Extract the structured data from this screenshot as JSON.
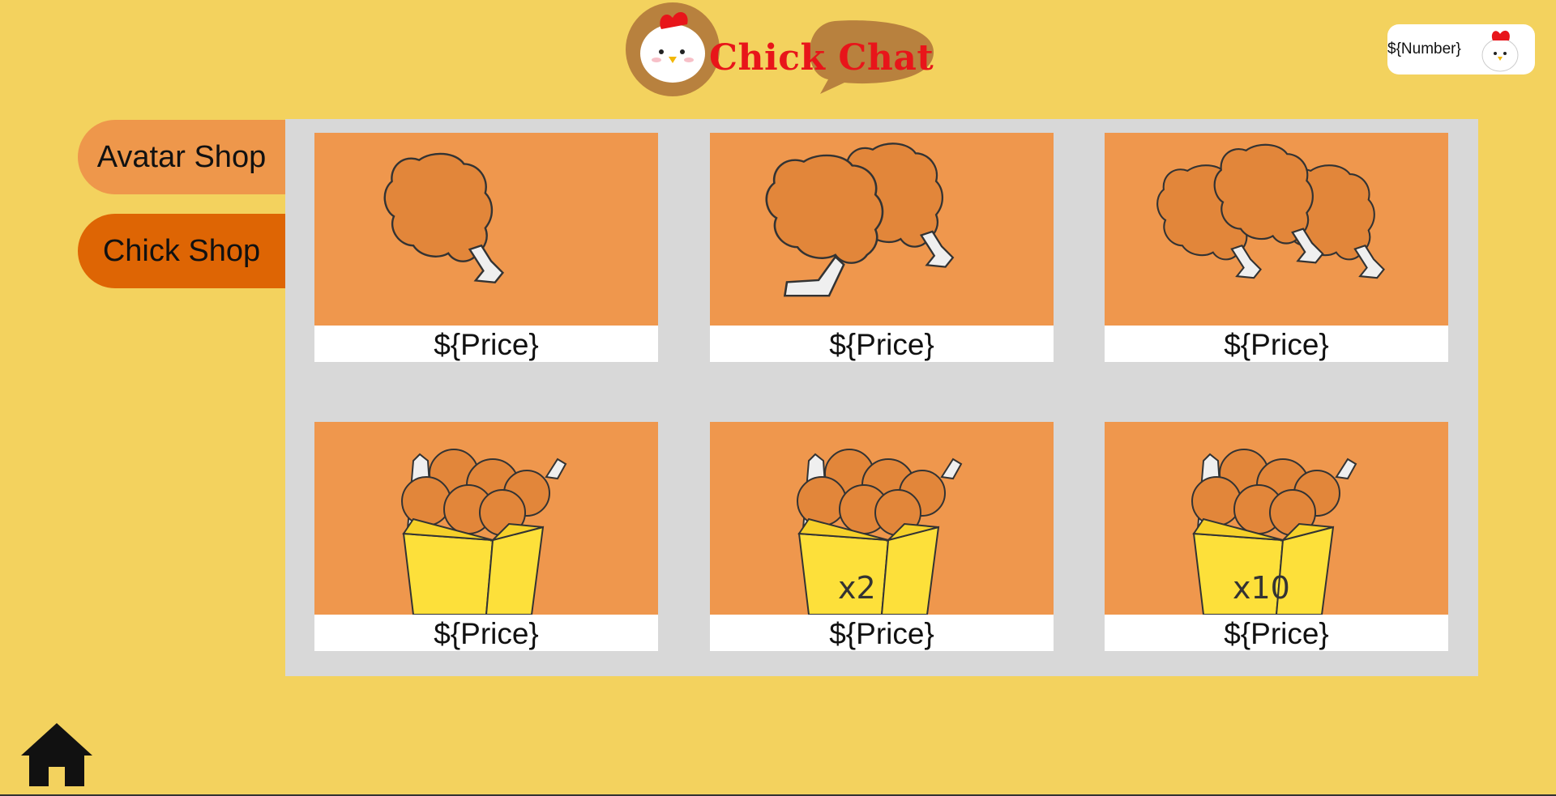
{
  "header": {
    "logo_text": "Chick Chat",
    "counter": "${Number}"
  },
  "sidebar": {
    "tabs": [
      {
        "label": "Avatar Shop",
        "active": false
      },
      {
        "label": "Chick Shop",
        "active": true
      }
    ]
  },
  "shop": {
    "items": [
      {
        "image": "one-drumstick",
        "price": "${Price}"
      },
      {
        "image": "two-drumsticks",
        "price": "${Price}"
      },
      {
        "image": "three-drumsticks",
        "price": "${Price}"
      },
      {
        "image": "chicken-bucket",
        "price": "${Price}"
      },
      {
        "image": "chicken-bucket-x2",
        "price": "${Price}",
        "badge": "x2"
      },
      {
        "image": "chicken-bucket-x10",
        "price": "${Price}",
        "badge": "x10"
      }
    ]
  },
  "colors": {
    "background": "#f3d25e",
    "tab_inactive": "#ee974b",
    "tab_active": "#de6504",
    "card_image_bg": "#ef974d",
    "panel": "#d8d8d8",
    "logo_text": "#e8151a"
  },
  "footer": {
    "home_icon": "home-icon"
  }
}
